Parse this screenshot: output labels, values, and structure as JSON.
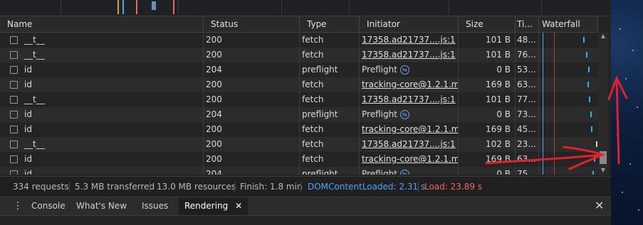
{
  "columns": {
    "name": "Name",
    "status": "Status",
    "type": "Type",
    "initiator": "Initiator",
    "size": "Size",
    "time": "Ti...",
    "waterfall": "Waterfall"
  },
  "rows": [
    {
      "name": "__t__",
      "status": "200",
      "type": "fetch",
      "initiator": "17358.ad21737....js:1",
      "initiator_link": true,
      "preflight_icon": false,
      "size": "101 B",
      "time": "48..."
    },
    {
      "name": "__t__",
      "status": "200",
      "type": "fetch",
      "initiator": "17358.ad21737....js:1",
      "initiator_link": true,
      "preflight_icon": false,
      "size": "101 B",
      "time": "76..."
    },
    {
      "name": "id",
      "status": "204",
      "type": "preflight",
      "initiator": "Preflight",
      "initiator_link": false,
      "preflight_icon": true,
      "size": "0 B",
      "time": "53..."
    },
    {
      "name": "id",
      "status": "200",
      "type": "fetch",
      "initiator": "tracking-core@1.2.1.m...",
      "initiator_link": true,
      "preflight_icon": false,
      "size": "169 B",
      "time": "63..."
    },
    {
      "name": "__t__",
      "status": "200",
      "type": "fetch",
      "initiator": "17358.ad21737....js:1",
      "initiator_link": true,
      "preflight_icon": false,
      "size": "101 B",
      "time": "77..."
    },
    {
      "name": "id",
      "status": "204",
      "type": "preflight",
      "initiator": "Preflight",
      "initiator_link": false,
      "preflight_icon": true,
      "size": "0 B",
      "time": "73..."
    },
    {
      "name": "id",
      "status": "200",
      "type": "fetch",
      "initiator": "tracking-core@1.2.1.m...",
      "initiator_link": true,
      "preflight_icon": false,
      "size": "169 B",
      "time": "45..."
    },
    {
      "name": "__t__",
      "status": "200",
      "type": "fetch",
      "initiator": "17358.ad21737....js:1",
      "initiator_link": true,
      "preflight_icon": false,
      "size": "102 B",
      "time": "23..."
    },
    {
      "name": "id",
      "status": "200",
      "type": "fetch",
      "initiator": "tracking-core@1.2.1.m...",
      "initiator_link": true,
      "preflight_icon": false,
      "size": "169 B",
      "time": "63..."
    },
    {
      "name": "id",
      "status": "204",
      "type": "preflight",
      "initiator": "Preflight",
      "initiator_link": false,
      "preflight_icon": true,
      "size": "0 B",
      "time": "75..."
    }
  ],
  "summary": {
    "requests": "334 requests",
    "transferred": "5.3 MB transferred",
    "resources": "13.0 MB resources",
    "finish": "Finish: 1.8 min",
    "dom_content_loaded": "DOMContentLoaded: 2.31 s",
    "load": "Load: 23.89 s"
  },
  "drawer": {
    "tabs": [
      "Console",
      "What's New",
      "Issues",
      "Rendering"
    ],
    "active_tab": "Rendering"
  },
  "colors": {
    "dom_content_loaded": "#4fa3f7",
    "load": "#e46962",
    "annotation": "#e0202a"
  }
}
